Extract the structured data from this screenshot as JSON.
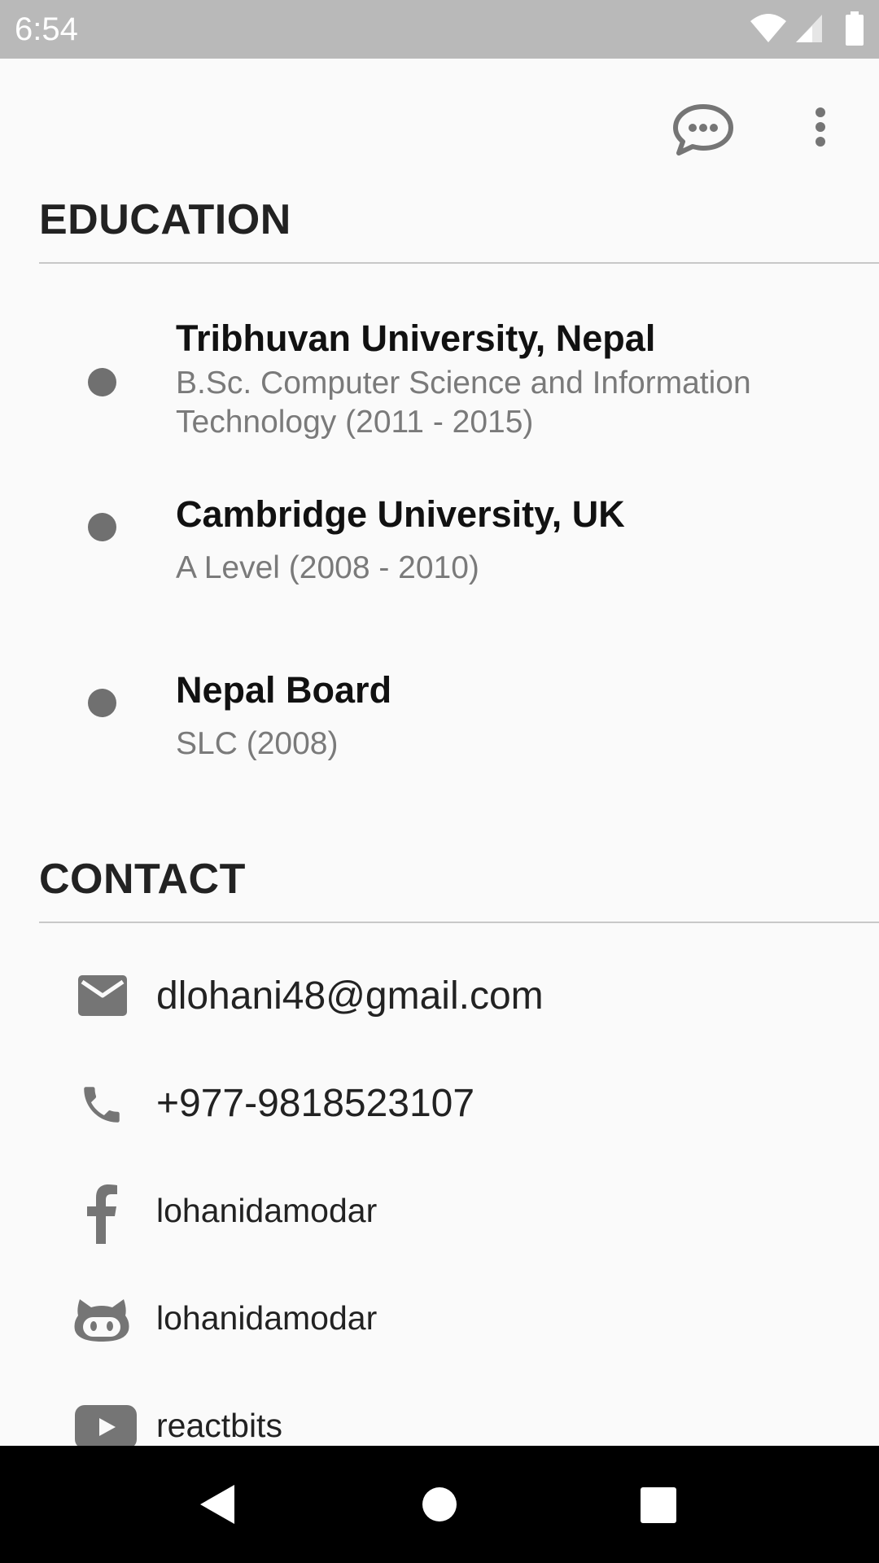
{
  "status_bar": {
    "time": "6:54",
    "icons": [
      "wifi-icon",
      "cell-signal-icon",
      "battery-icon"
    ]
  },
  "actions": {
    "icons": [
      "chat-icon",
      "more-vert-icon"
    ],
    "icon_color": "#757575"
  },
  "education": {
    "heading": "EDUCATION",
    "items": [
      {
        "title": "Tribhuvan University, Nepal",
        "subtitle": "B.Sc. Computer Science and Information Technology (2011 - 2015)"
      },
      {
        "title": "Cambridge University, UK",
        "subtitle": "A Level (2008 - 2010)"
      },
      {
        "title": "Nepal Board",
        "subtitle": "SLC (2008)"
      }
    ]
  },
  "contact": {
    "heading": "CONTACT",
    "items": [
      {
        "icon": "email-icon",
        "label": "dlohani48@gmail.com"
      },
      {
        "icon": "phone-icon",
        "label": "+977-9818523107"
      },
      {
        "icon": "facebook-icon",
        "label": "lohanidamodar"
      },
      {
        "icon": "github-icon",
        "label": "lohanidamodar"
      },
      {
        "icon": "youtube-icon",
        "label": "reactbits"
      }
    ]
  },
  "nav_bar": {
    "buttons": [
      "back-icon",
      "home-icon",
      "recents-icon"
    ]
  },
  "colors": {
    "status_bar": "#b9b9b9",
    "background": "#fafafa",
    "icon_gray": "#757575",
    "nav_bar": "#000000"
  }
}
